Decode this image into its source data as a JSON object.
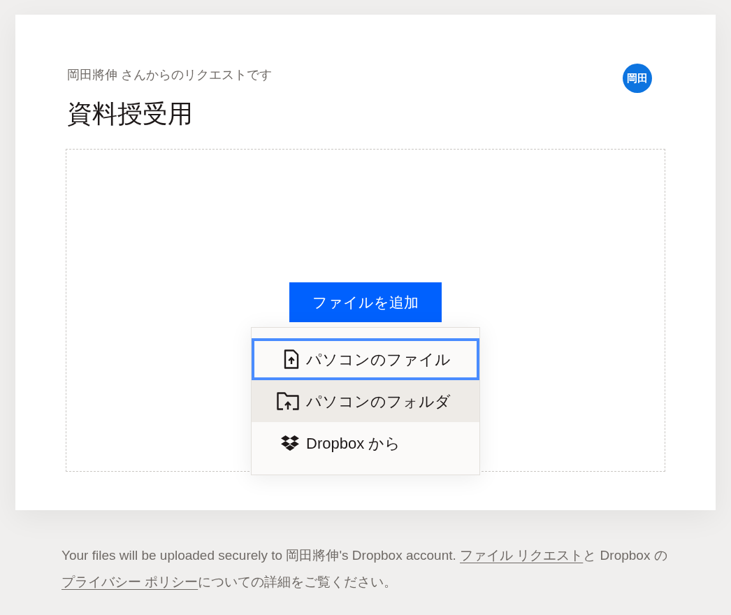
{
  "request": {
    "subtitle": "岡田將伸 さんからのリクエストです",
    "title": "資料授受用",
    "avatar": "岡田"
  },
  "dropzone": {
    "button": "ファイルを追加",
    "menu": [
      {
        "kind": "file",
        "label": "パソコンのファイル",
        "focused": true,
        "highlighted": false
      },
      {
        "kind": "folder",
        "label": "パソコンのフォルダ",
        "focused": false,
        "highlighted": true
      },
      {
        "kind": "dropbox",
        "label": "Dropbox から",
        "focused": false,
        "highlighted": false
      }
    ]
  },
  "footer": {
    "lead": "Your files will be uploaded securely to 岡田將伸's Dropbox account. ",
    "link_1": "ファイル リクエスト",
    "middle": "と Dropbox の",
    "link_2": "プライバシー ポリシー",
    "tail": "についての詳細をご覧ください。"
  }
}
